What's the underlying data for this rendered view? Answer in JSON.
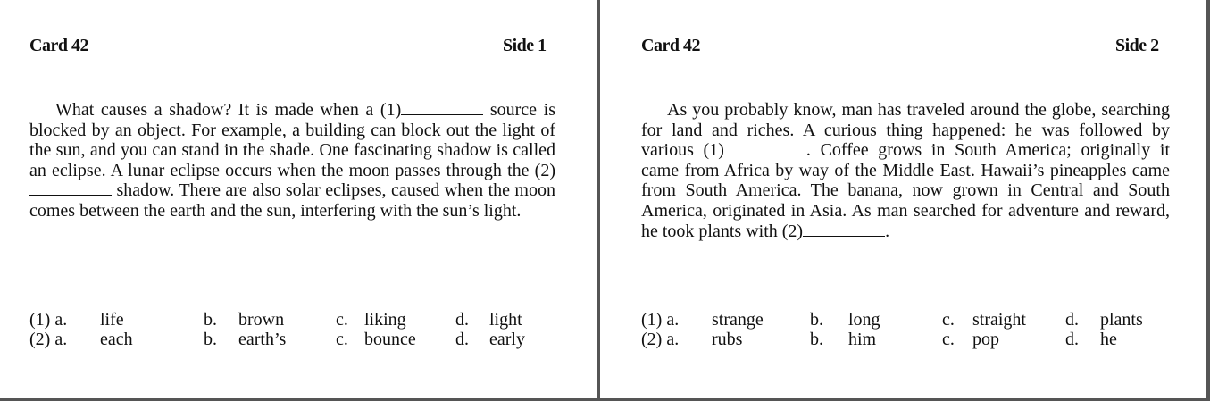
{
  "cards": [
    {
      "title": "Card 42",
      "side": "Side 1",
      "text": {
        "p1": "What causes a shadow? It is made when a (1)",
        "p2": " source is blocked by an object. For example, a building can block out the light of the sun, and you can stand in the shade. One fascinating shadow is called an eclipse. A lunar eclipse occurs when the moon passes through the (2)",
        "p3": " shadow. There are also solar eclipses, caused when the moon comes between the earth and the sun, interfering with the sun’s light."
      },
      "options": [
        {
          "num": "(1) a.",
          "a": "life",
          "b_label": "b.",
          "b": "brown",
          "c_label": "c.",
          "c": "liking",
          "d_label": "d.",
          "d": "light"
        },
        {
          "num": "(2) a.",
          "a": "each",
          "b_label": "b.",
          "b": "earth’s",
          "c_label": "c.",
          "c": "bounce",
          "d_label": "d.",
          "d": "early"
        }
      ]
    },
    {
      "title": "Card 42",
      "side": "Side 2",
      "text": {
        "p1": "As you probably know, man has traveled around the globe, searching for land and riches. A curious thing happened: he was followed by various (1)",
        "p2": ". Coffee grows in South America; originally it came from Africa by way of the Middle East. Hawaii’s pineapples came from South America. The banana, now grown in Central and South America, originated in Asia. As man searched for adventure and reward, he took plants with (2)",
        "p3": "."
      },
      "options": [
        {
          "num": "(1) a.",
          "a": "strange",
          "b_label": "b.",
          "b": "long",
          "c_label": "c.",
          "c": "straight",
          "d_label": "d.",
          "d": "plants"
        },
        {
          "num": "(2) a.",
          "a": "rubs",
          "b_label": "b.",
          "b": "him",
          "c_label": "c.",
          "c": "pop",
          "d_label": "d.",
          "d": "he"
        }
      ]
    }
  ]
}
